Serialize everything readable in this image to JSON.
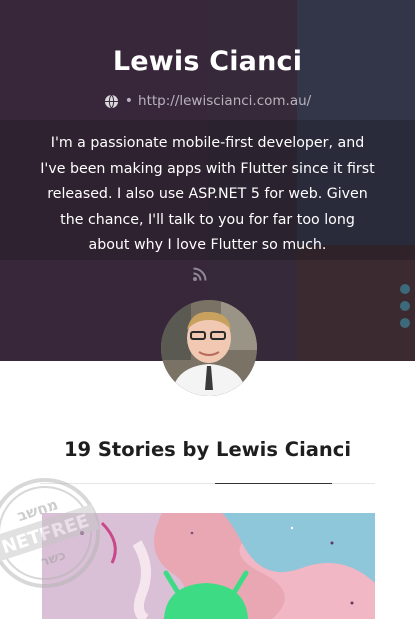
{
  "profile": {
    "name": "Lewis Cianci",
    "website": "http://lewiscianci.com.au/",
    "website_separator": "•",
    "bio_lines": [
      "I'm a passionate mobile-first developer, and",
      "I've been making apps with Flutter since it first",
      "released. I also use ASP.NET 5 for web. Given",
      "the chance, I'll talk to you for far too long",
      "about why I love Flutter so much."
    ]
  },
  "stories": {
    "heading": "19 Stories by Lewis Cianci"
  },
  "watermark": {
    "top_text": "מחשב",
    "middle_text": "NETFREE",
    "bottom_text": "כשר"
  },
  "colors": {
    "hero_background": "#3a2c3e",
    "heading_text": "#1e1e1e",
    "accent_dots": "#3d6a7a",
    "android_green": "#3ddc84"
  },
  "icons": {
    "website": "globe-icon",
    "feed": "rss-icon"
  }
}
